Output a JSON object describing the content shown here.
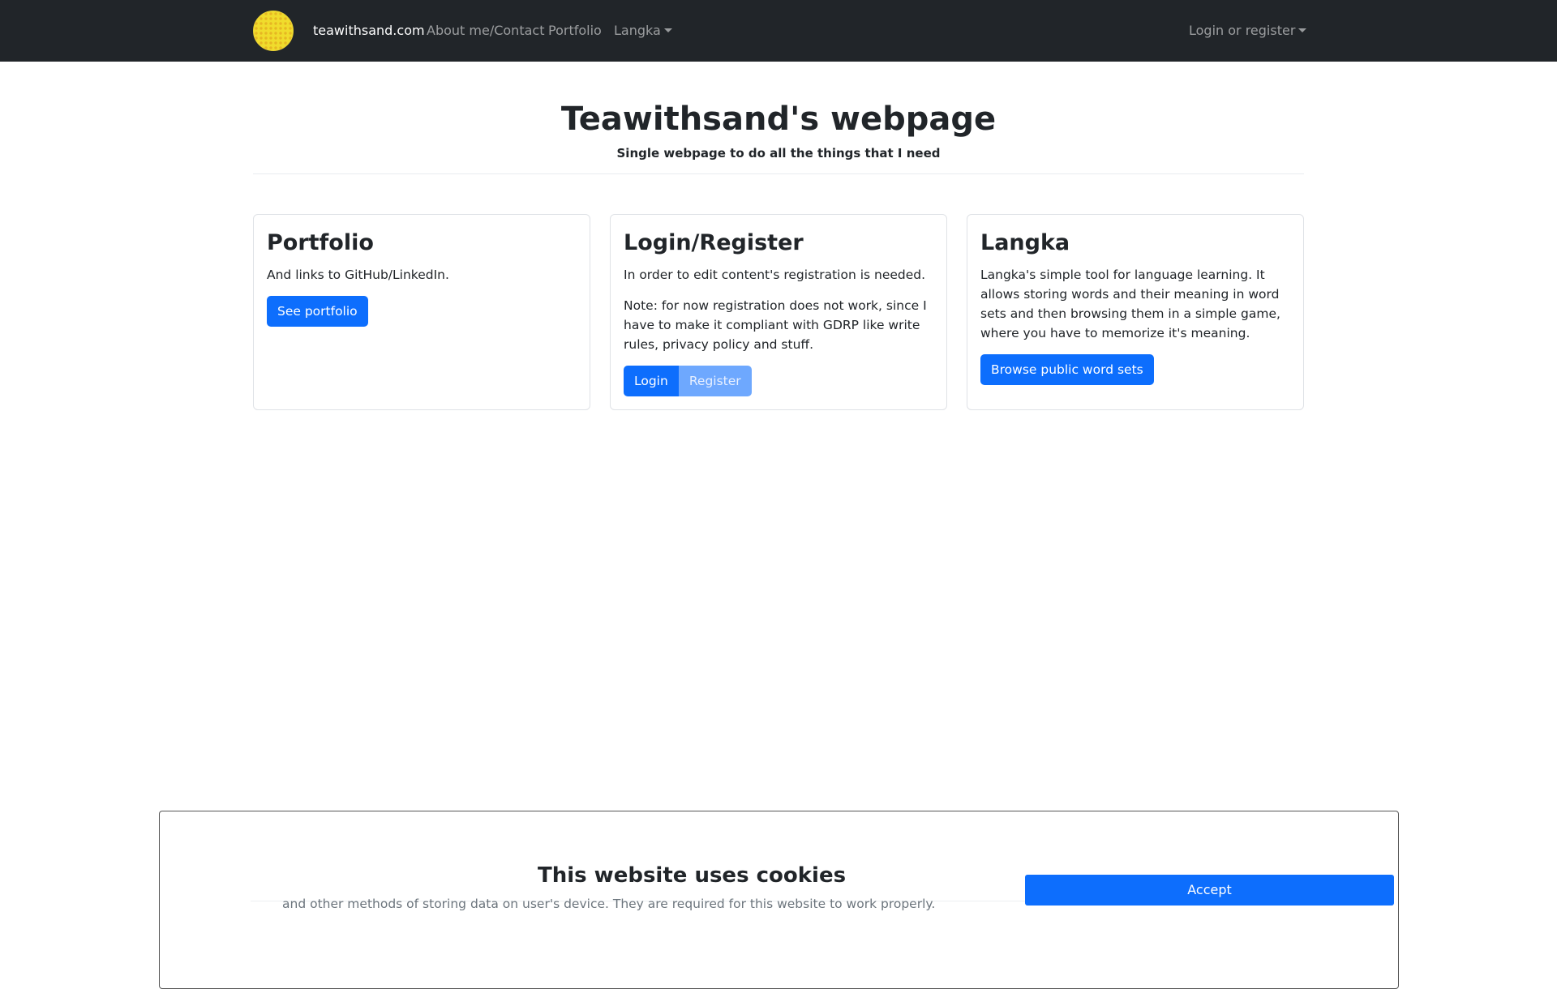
{
  "navbar": {
    "brand": "teawithsand.com",
    "links": [
      "About me/Contact",
      "Portfolio",
      "Langka"
    ],
    "account_menu": "Login or register"
  },
  "header": {
    "title": "Teawithsand's webpage",
    "subtitle": "Single webpage to do all the things that I need"
  },
  "cards": {
    "portfolio": {
      "title": "Portfolio",
      "text": "And links to GitHub/LinkedIn.",
      "button": "See portfolio"
    },
    "login": {
      "title": "Login/Register",
      "text": "In order to edit content's registration is needed.",
      "note": "Note: for now registration does not work, since I have to make it compliant with GDRP like write rules, privacy policy and stuff.",
      "login_button": "Login",
      "register_button": "Register"
    },
    "langka": {
      "title": "Langka",
      "text": "Langka's simple tool for language learning. It allows storing words and their meaning in word sets and then browsing them in a simple game, where you have to memorize it's meaning.",
      "button": "Browse public word sets"
    }
  },
  "cookie_banner": {
    "title": "This website uses cookies",
    "text": "and other methods of storing data on user's device. They are required for this website to work properly.",
    "accept": "Accept"
  },
  "colors": {
    "navbar_bg": "#212529",
    "primary": "#0d6efd",
    "primary_disabled": "#6ea8fe",
    "logo": "#f0dc2c"
  }
}
